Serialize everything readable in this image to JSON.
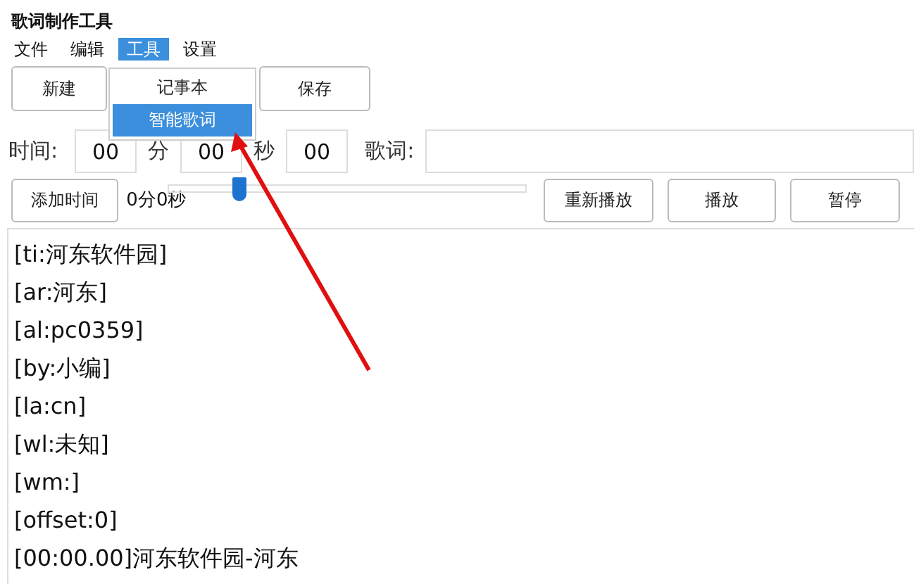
{
  "window": {
    "title": "歌词制作工具"
  },
  "menu": [
    {
      "label": "文件",
      "selected": false
    },
    {
      "label": "编辑",
      "selected": false
    },
    {
      "label": "工具",
      "selected": true
    },
    {
      "label": "设置",
      "selected": false
    }
  ],
  "dropdown": [
    {
      "label": "记事本",
      "selected": false
    },
    {
      "label": "智能歌词",
      "selected": true
    }
  ],
  "file_buttons": [
    "新建",
    "保存"
  ],
  "time": {
    "label": "时间:",
    "minutes": "00",
    "min_unit": "分",
    "seconds": "00",
    "sec_unit": "秒",
    "hundredths": "00",
    "lyric_label": "歌词:"
  },
  "add_time_button": "添加时间",
  "position": "0分0秒",
  "seek": {
    "level": 0.2
  },
  "play_buttons": [
    "重新播放",
    "播放",
    "暂停"
  ],
  "lyrics": [
    "[ti:河东软件园]",
    "[ar:河东]",
    "[al:pc0359]",
    "[by:小编]",
    "[la:cn]",
    "[wl:未知]",
    "[wm:]",
    "[offset:0]",
    "[00:00.00]河东软件园-河东"
  ]
}
